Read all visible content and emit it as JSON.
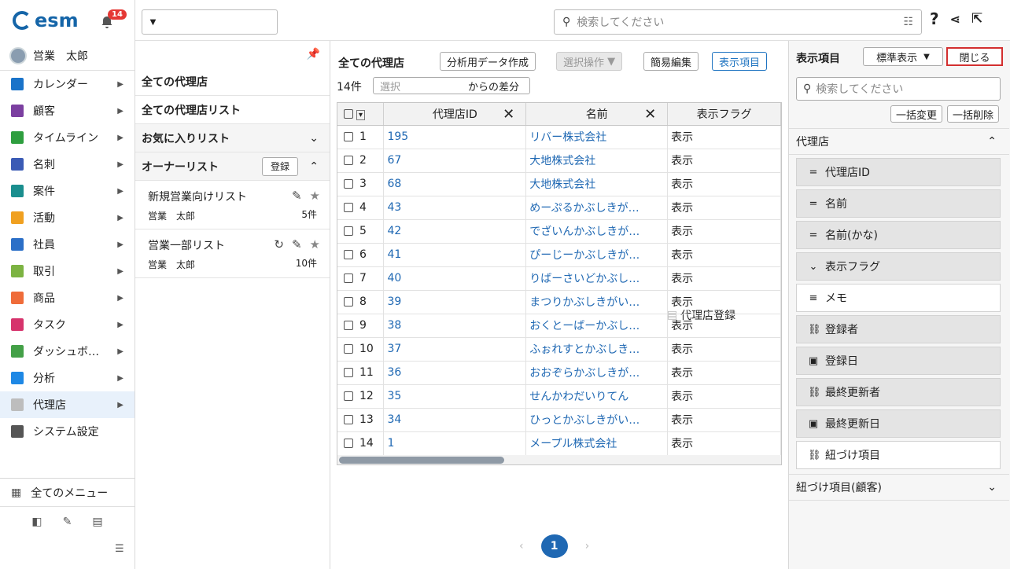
{
  "app": {
    "logo_text": "esm",
    "notification_count": "14",
    "user_name": "営業　太郎"
  },
  "sidebar": {
    "items": [
      {
        "label": "カレンダー",
        "color": "#1a73c9"
      },
      {
        "label": "顧客",
        "color": "#7b3fa0"
      },
      {
        "label": "タイムライン",
        "color": "#2e9e3f"
      },
      {
        "label": "名刺",
        "color": "#3b5bb5"
      },
      {
        "label": "案件",
        "color": "#1a8e8e"
      },
      {
        "label": "活動",
        "color": "#f0a020"
      },
      {
        "label": "社員",
        "color": "#2b6fc7"
      },
      {
        "label": "取引",
        "color": "#7cb342"
      },
      {
        "label": "商品",
        "color": "#ef6c3a"
      },
      {
        "label": "タスク",
        "color": "#d6336c"
      },
      {
        "label": "ダッシュボ…",
        "color": "#43a047"
      },
      {
        "label": "分析",
        "color": "#1e88e5"
      },
      {
        "label": "代理店",
        "color": "#bdbdbd"
      },
      {
        "label": "システム設定",
        "color": "#555555"
      }
    ],
    "all_menu_label": "全てのメニュー"
  },
  "topbar": {
    "register_label": "代理店登録",
    "search_placeholder": "検索してください"
  },
  "lists": {
    "all_agencies": "全ての代理店",
    "all_agency_lists": "全ての代理店リスト",
    "favorites": "お気に入りリスト",
    "owner_lists": "オーナーリスト",
    "register_label": "登録",
    "entries": [
      {
        "name": "新規営業向けリスト",
        "owner": "営業　太郎",
        "count": "5件"
      },
      {
        "name": "営業一部リスト",
        "owner": "営業　太郎",
        "count": "10件"
      }
    ]
  },
  "main": {
    "title": "全ての代理店",
    "buttons": {
      "analysis": "分析用データ作成",
      "select_ops": "選択操作",
      "quick_edit": "簡易編集",
      "display_items": "表示項目"
    },
    "count": "14件",
    "diff_select_placeholder": "選択",
    "diff_suffix": "からの差分",
    "columns": {
      "id": "代理店ID",
      "name": "名前",
      "flag": "表示フラグ"
    },
    "rows": [
      {
        "n": "1",
        "id": "195",
        "name": "リバー株式会社",
        "flag": "表示"
      },
      {
        "n": "2",
        "id": "67",
        "name": "大地株式会社",
        "flag": "表示"
      },
      {
        "n": "3",
        "id": "68",
        "name": "大地株式会社",
        "flag": "表示"
      },
      {
        "n": "4",
        "id": "43",
        "name": "めーぷるかぶしきが…",
        "flag": "表示"
      },
      {
        "n": "5",
        "id": "42",
        "name": "でざいんかぶしきが…",
        "flag": "表示"
      },
      {
        "n": "6",
        "id": "41",
        "name": "ぴーじーかぶしきが…",
        "flag": "表示"
      },
      {
        "n": "7",
        "id": "40",
        "name": "りばーさいどかぶし…",
        "flag": "表示"
      },
      {
        "n": "8",
        "id": "39",
        "name": "まつりかぶしきがい…",
        "flag": "表示"
      },
      {
        "n": "9",
        "id": "38",
        "name": "おくとーばーかぶし…",
        "flag": "表示"
      },
      {
        "n": "10",
        "id": "37",
        "name": "ふぉれすとかぶしき…",
        "flag": "表示"
      },
      {
        "n": "11",
        "id": "36",
        "name": "おおぞらかぶしきが…",
        "flag": "表示"
      },
      {
        "n": "12",
        "id": "35",
        "name": "せんかわだいりてん",
        "flag": "表示"
      },
      {
        "n": "13",
        "id": "34",
        "name": "ひっとかぶしきがい…",
        "flag": "表示"
      },
      {
        "n": "14",
        "id": "1",
        "name": "メープル株式会社",
        "flag": "表示"
      }
    ],
    "page": "1"
  },
  "rpanel": {
    "title": "表示項目",
    "preset": "標準表示",
    "close_label": "閉じる",
    "search_placeholder": "検索してください",
    "bulk_change": "一括変更",
    "bulk_delete": "一括削除",
    "section1": "代理店",
    "section2": "紐づけ項目(顧客)",
    "fields": [
      {
        "label": "代理店ID",
        "icon": "text-line-icon",
        "glyph": "=",
        "active": true
      },
      {
        "label": "名前",
        "icon": "text-line-icon",
        "glyph": "=",
        "active": true
      },
      {
        "label": "名前(かな)",
        "icon": "text-line-icon",
        "glyph": "=",
        "active": true
      },
      {
        "label": "表示フラグ",
        "icon": "dropdown-circle-icon",
        "glyph": "⌄",
        "active": true
      },
      {
        "label": "メモ",
        "icon": "multiline-text-icon",
        "glyph": "≡",
        "active": false
      },
      {
        "label": "登録者",
        "icon": "link-icon",
        "glyph": "⛓",
        "active": true
      },
      {
        "label": "登録日",
        "icon": "calendar-icon",
        "glyph": "▣",
        "active": true
      },
      {
        "label": "最終更新者",
        "icon": "link-icon",
        "glyph": "⛓",
        "active": true
      },
      {
        "label": "最終更新日",
        "icon": "calendar-icon",
        "glyph": "▣",
        "active": true
      },
      {
        "label": "紐づけ項目",
        "icon": "link-icon",
        "glyph": "⛓",
        "active": false
      }
    ]
  }
}
